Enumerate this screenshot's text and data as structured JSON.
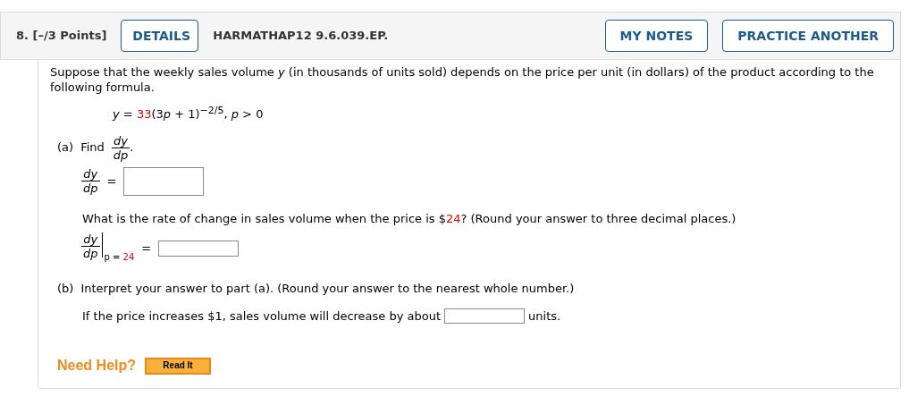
{
  "header": {
    "number": "8.",
    "points": "[–/3 Points]",
    "details_button": "DETAILS",
    "code": "HARMATHAP12 9.6.039.EP.",
    "right_buttons": [
      "MY NOTES",
      "PRACTICE ANOTHER"
    ]
  },
  "intro": "Suppose that the weekly sales volume *y* (in thousands of units sold) depends on the price per unit (in dollars) of the product according to the following formula.",
  "formula": {
    "lhs": "*y* =",
    "coefficient": "33",
    "base_open": "(3",
    "base_variable": "p",
    "base_close": " + 1)",
    "exponent": "−2/5",
    "condition": ", *p* > 0"
  },
  "part_a": {
    "label": "(a)",
    "prompt": "Find",
    "fraction": {
      "numerator": "dy",
      "denominator": "dp"
    },
    "prompt_end": ".",
    "answer_fraction": {
      "numerator": "dy",
      "denominator": "dp"
    },
    "equals": "=",
    "question": {
      "before": "What is the rate of change in sales volume when the price is $",
      "value": "24",
      "after": "? (Round your answer to three decimal places.)"
    },
    "eval_fraction": {
      "numerator": "dy",
      "denominator": "dp"
    },
    "eval_at": {
      "variable": "p =",
      "value": "24"
    },
    "eval_equals": "="
  },
  "part_b": {
    "label": "(b)",
    "instruction": "Interpret your answer to part (a). (Round your answer to the nearest whole number.)",
    "sentence": "If the price increases $1, sales volume will decrease by about",
    "unit": "units."
  },
  "help": {
    "label": "Need Help?",
    "button": "Read It"
  }
}
